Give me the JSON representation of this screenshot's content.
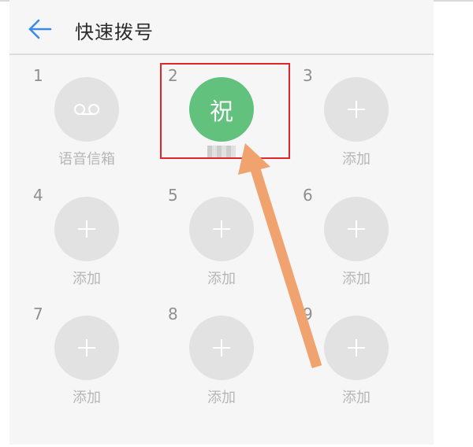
{
  "header": {
    "title": "快速拨号"
  },
  "colors": {
    "contact_avatar": "#62c17c",
    "empty_slot": "#e2e2e2",
    "highlight_box": "#e2262a",
    "arrow": "#f0a36e",
    "back_icon": "#3c8be2"
  },
  "slots": [
    {
      "digit": "1",
      "icon": "voicemail-icon",
      "label": "语音信箱"
    },
    {
      "digit": "2",
      "icon": "contact-avatar",
      "avatar_char": "祝"
    },
    {
      "digit": "3",
      "icon": "plus-icon",
      "label": "添加"
    },
    {
      "digit": "4",
      "icon": "plus-icon",
      "label": "添加"
    },
    {
      "digit": "5",
      "icon": "plus-icon",
      "label": "添加"
    },
    {
      "digit": "6",
      "icon": "plus-icon",
      "label": "添加"
    },
    {
      "digit": "7",
      "icon": "plus-icon",
      "label": "添加"
    },
    {
      "digit": "8",
      "icon": "plus-icon",
      "label": "添加"
    },
    {
      "digit": "9",
      "icon": "plus-icon",
      "label": "添加"
    }
  ]
}
